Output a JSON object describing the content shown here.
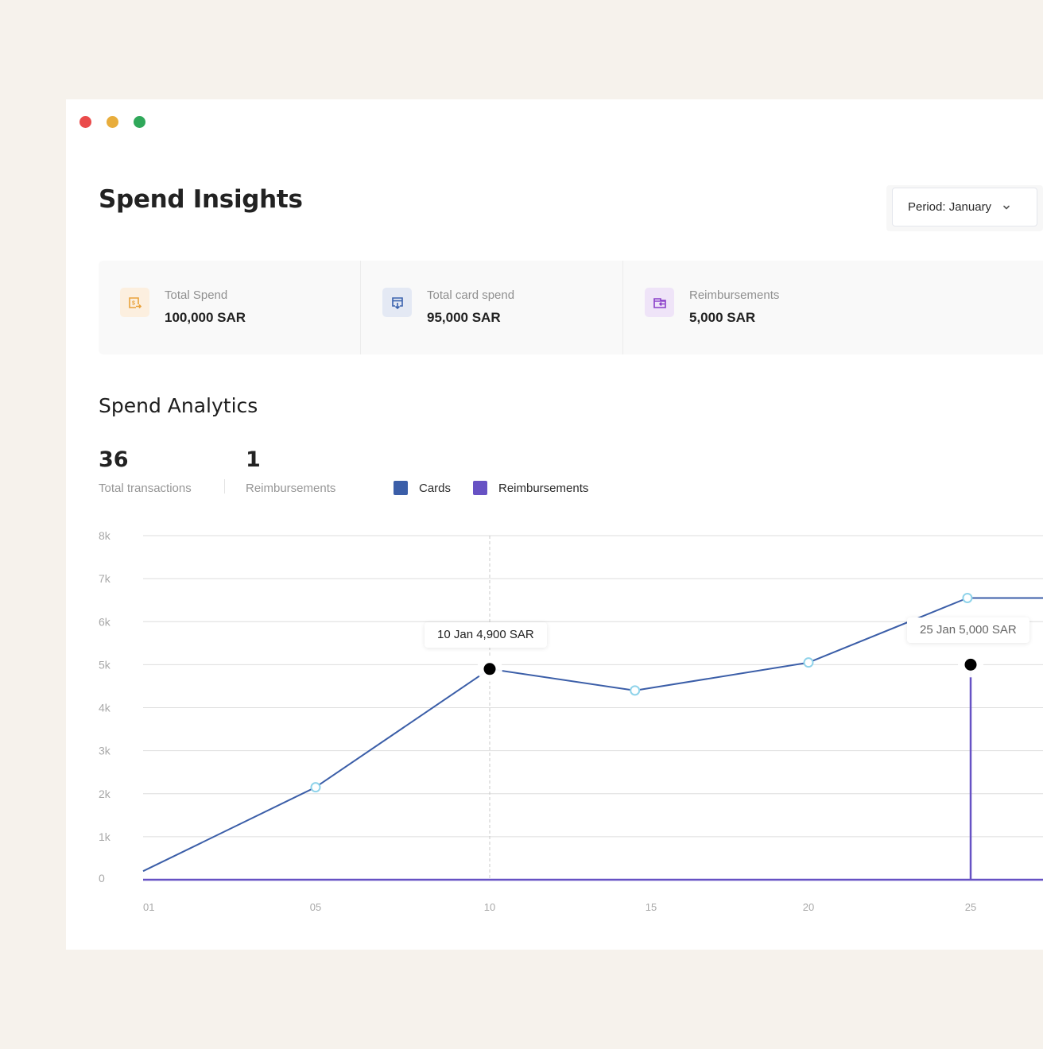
{
  "window": {
    "traffic_lights": [
      "close",
      "minimize",
      "maximize"
    ]
  },
  "header": {
    "title": "Spend Insights",
    "period": {
      "label": "Period: January",
      "icon": "chevron-down-icon"
    }
  },
  "stats": [
    {
      "label": "Total Spend",
      "value": "100,000 SAR",
      "icon": "dollar-transfer-icon",
      "color": "#e9a23b",
      "bg": "#fcefdf"
    },
    {
      "label": "Total card spend",
      "value": "95,000 SAR",
      "icon": "card-download-icon",
      "color": "#3a62ad",
      "bg": "#e4e9f4"
    },
    {
      "label": "Reimbursements",
      "value": "5,000 SAR",
      "icon": "wallet-return-icon",
      "color": "#8a3fc9",
      "bg": "#efe4f8"
    }
  ],
  "analytics": {
    "title": "Spend Analytics",
    "metrics": [
      {
        "value": "36",
        "label": "Total transactions"
      },
      {
        "value": "1",
        "label": "Reimbursements"
      }
    ],
    "legend": [
      {
        "label": "Cards",
        "color": "#3b5ea8"
      },
      {
        "label": "Reimbursements",
        "color": "#6752c4"
      }
    ]
  },
  "chart_data": {
    "type": "line",
    "title": "Spend Analytics",
    "xlabel": "",
    "ylabel": "",
    "x_ticks": [
      "01",
      "05",
      "10",
      "15",
      "20",
      "25"
    ],
    "y_ticks": [
      "0",
      "1k",
      "2k",
      "3k",
      "4k",
      "5k",
      "6k",
      "7k",
      "8k"
    ],
    "ylim": [
      0,
      8000
    ],
    "xlim": [
      1,
      28
    ],
    "grid": true,
    "legend_position": "top",
    "series": [
      {
        "name": "Cards",
        "color": "#3b5ea8",
        "points": [
          {
            "x": 1,
            "y": 200
          },
          {
            "x": 5,
            "y": 2150
          },
          {
            "x": 10,
            "y": 4900
          },
          {
            "x": 14.5,
            "y": 4400
          },
          {
            "x": 20,
            "y": 5050
          },
          {
            "x": 24.9,
            "y": 6550
          },
          {
            "x": 28,
            "y": 6550
          }
        ]
      },
      {
        "name": "Reimbursements",
        "color": "#6752c4",
        "points": [
          {
            "x": 1,
            "y": 0
          },
          {
            "x": 25,
            "y": 0
          },
          {
            "x": 25,
            "y": 5000
          },
          {
            "x": 25,
            "y": 0
          },
          {
            "x": 28,
            "y": 0
          }
        ]
      }
    ],
    "highlights": [
      {
        "series": "Cards",
        "x": 10,
        "y": 4900,
        "label": "10 Jan 4,900 SAR",
        "guide": "dashed"
      },
      {
        "series": "Reimbursements",
        "x": 25,
        "y": 5000,
        "label": "25 Jan 5,000 SAR"
      }
    ]
  }
}
